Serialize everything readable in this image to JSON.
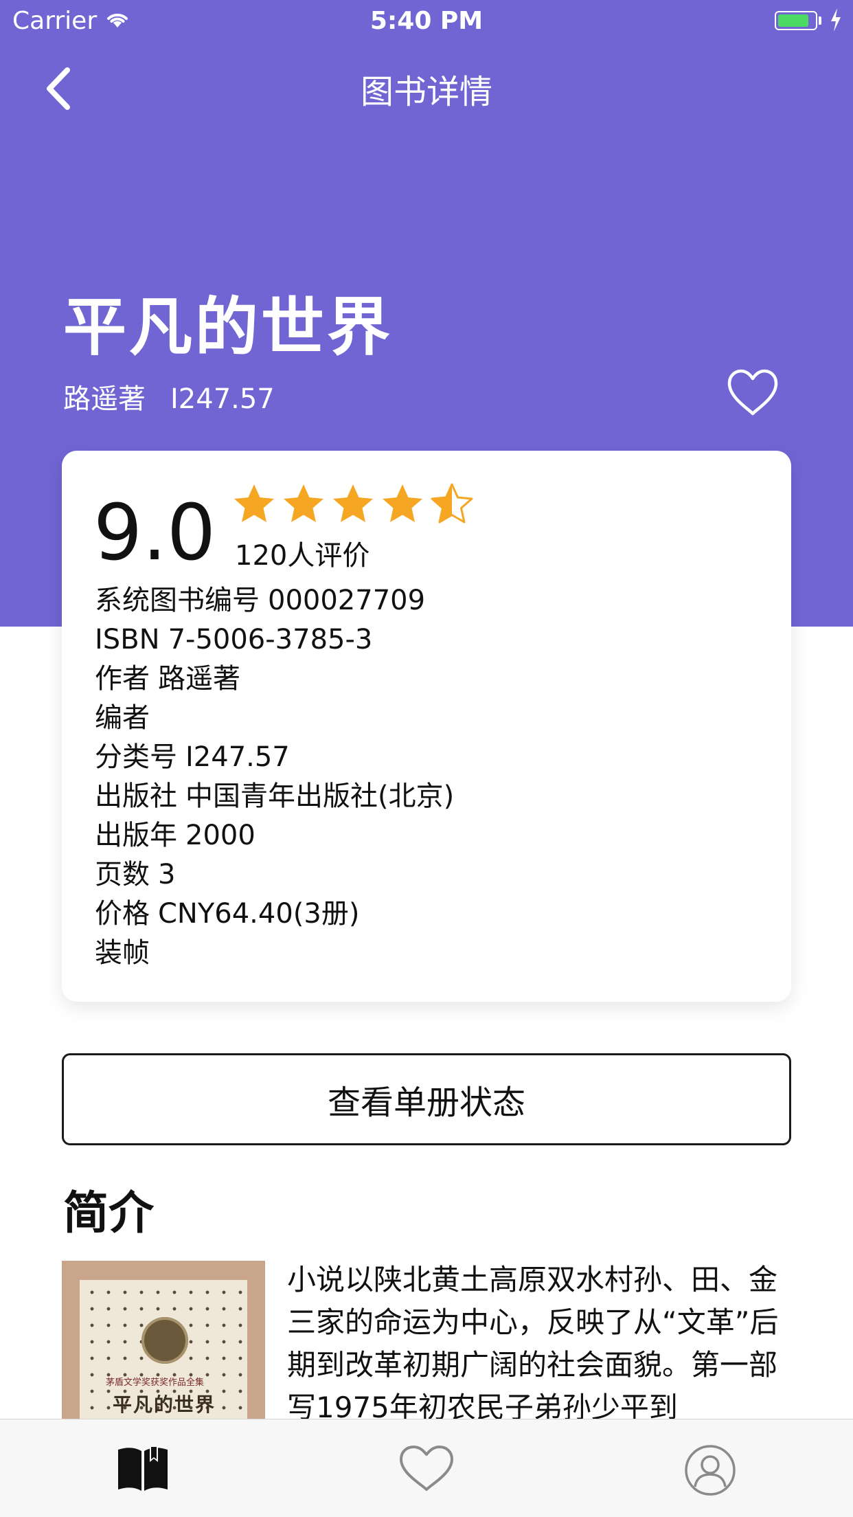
{
  "status_bar": {
    "carrier": "Carrier",
    "time": "5:40 PM",
    "battery_level": 0.85
  },
  "nav": {
    "title": "图书详情"
  },
  "book": {
    "title": "平凡的世界",
    "author_line": "路遥著",
    "call_number": "I247.57"
  },
  "rating": {
    "score": "9.0",
    "stars": 4.5,
    "count_label": "120人评价"
  },
  "details": [
    {
      "label": "系统图书编号",
      "value": "000027709"
    },
    {
      "label": "ISBN",
      "value": "7-5006-3785-3"
    },
    {
      "label": "作者",
      "value": "路遥著"
    },
    {
      "label": "编者",
      "value": ""
    },
    {
      "label": "分类号",
      "value": "I247.57"
    },
    {
      "label": "出版社",
      "value": "中国青年出版社(北京)"
    },
    {
      "label": "出版年",
      "value": "2000"
    },
    {
      "label": "页数",
      "value": "3"
    },
    {
      "label": "价格",
      "value": "CNY64.40(3册)"
    },
    {
      "label": "装帧",
      "value": ""
    }
  ],
  "volumes_button": "查看单册状态",
  "intro": {
    "heading": "简介",
    "cover_subtitle": "茅盾文学奖获奖作品全集",
    "cover_title": "平凡的世界",
    "text": "小说以陕北黄土高原双水村孙、田、金三家的命运为中心，反映了从“文革”后期到改革初期广阔的社会面貌。第一部写1975年初农民子弟孙少平到"
  },
  "tabs": [
    {
      "name": "books",
      "active": true
    },
    {
      "name": "favorites",
      "active": false
    },
    {
      "name": "profile",
      "active": false
    }
  ],
  "colors": {
    "hero": "#7065d3",
    "star": "#f5a623",
    "battery": "#4cd964"
  }
}
